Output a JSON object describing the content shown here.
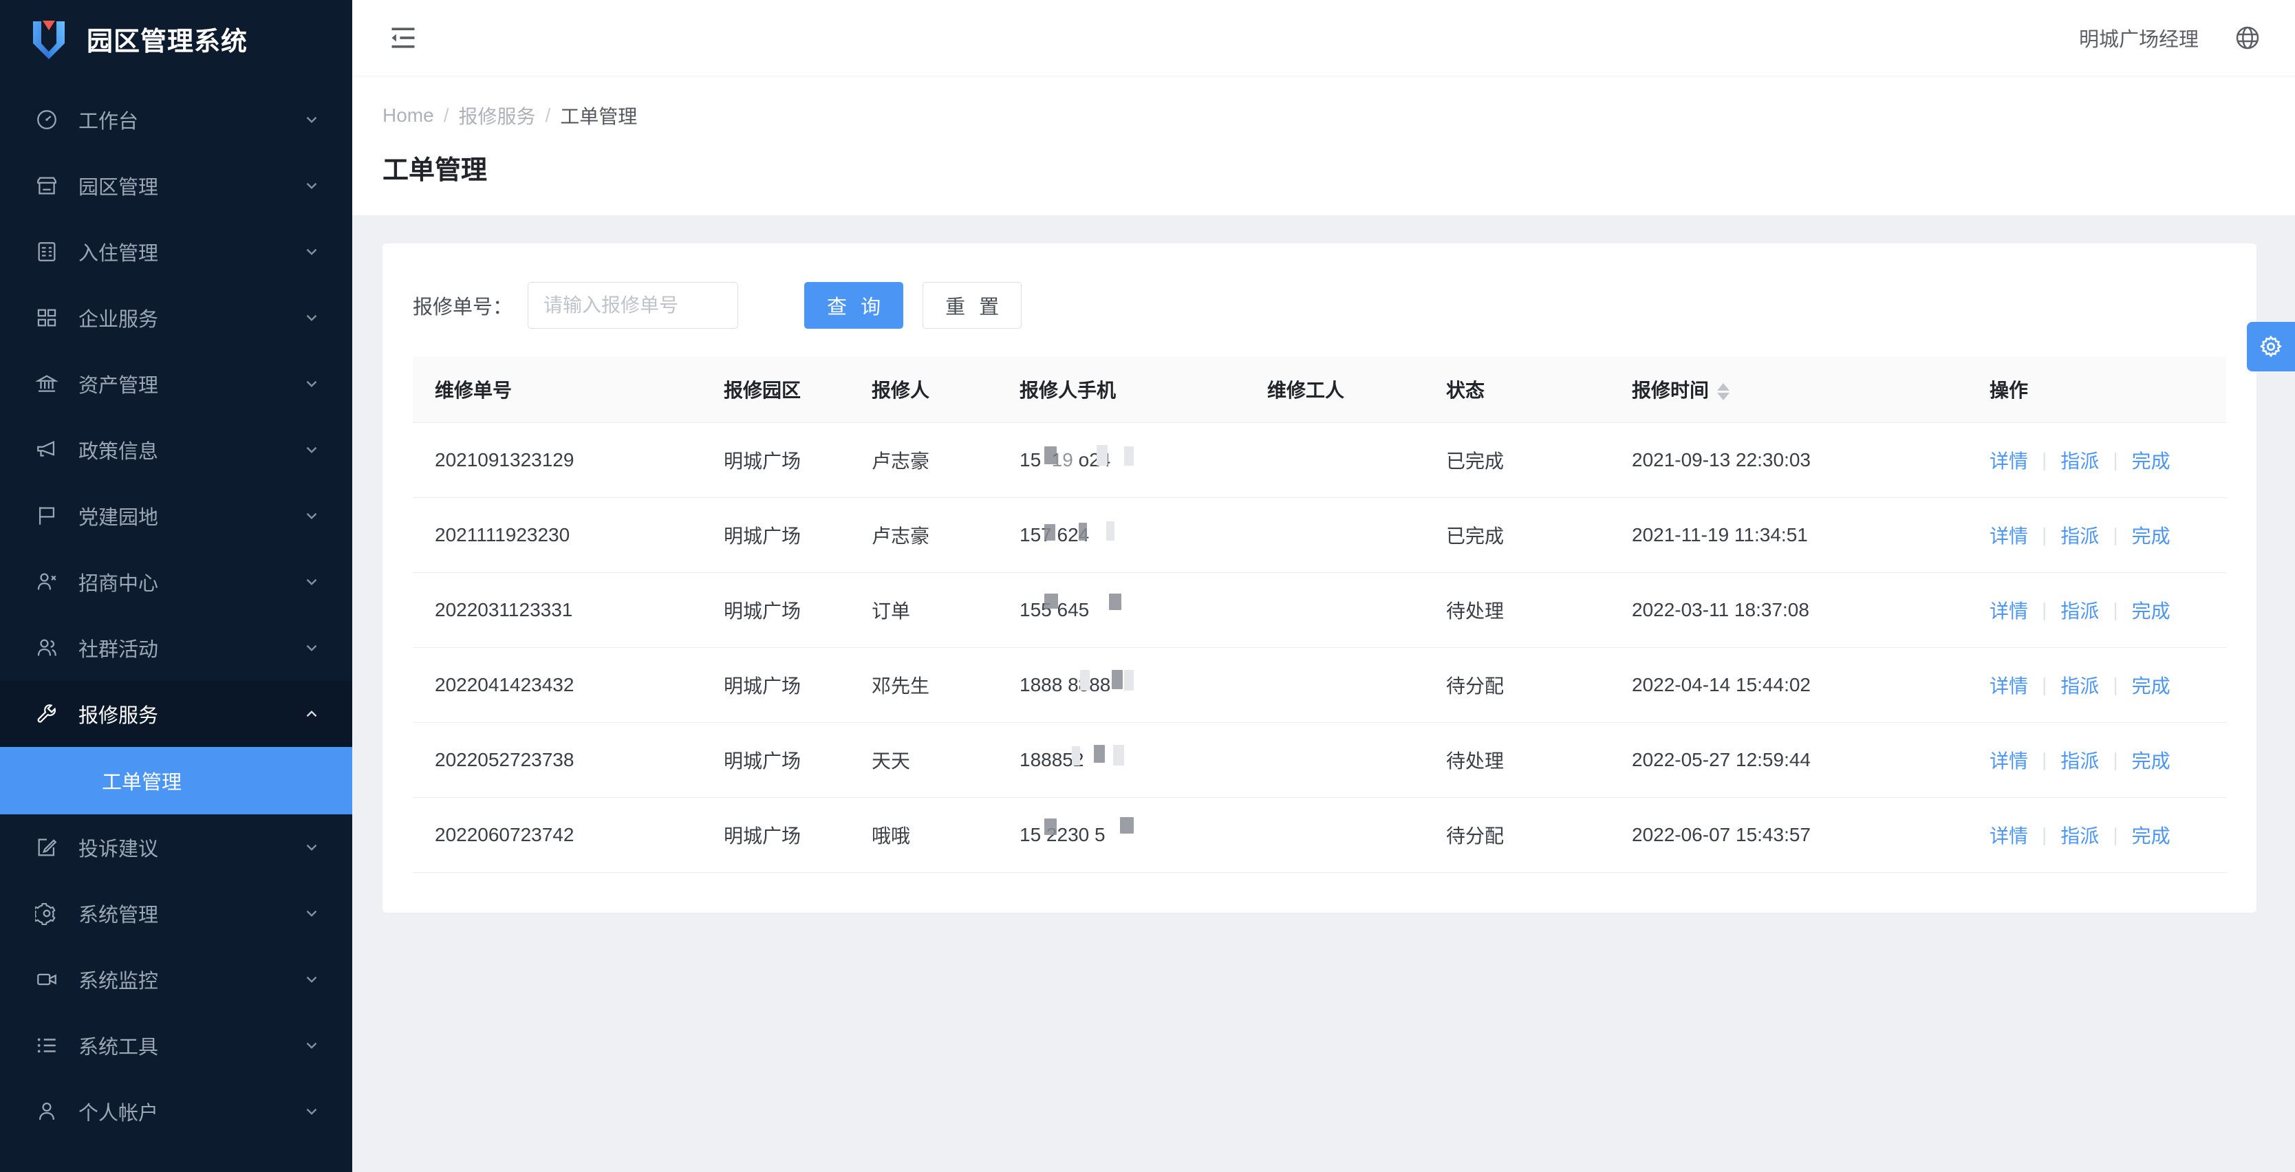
{
  "brand": {
    "title": "园区管理系统",
    "logo_icon": "shield-logo-icon"
  },
  "sidebar": {
    "items": [
      {
        "label": "工作台",
        "icon": "dashboard-icon",
        "arrow": "chevron-down-icon"
      },
      {
        "label": "园区管理",
        "icon": "shop-icon",
        "arrow": "chevron-down-icon"
      },
      {
        "label": "入住管理",
        "icon": "database-icon",
        "arrow": "chevron-down-icon"
      },
      {
        "label": "企业服务",
        "icon": "appstore-icon",
        "arrow": "chevron-down-icon"
      },
      {
        "label": "资产管理",
        "icon": "bank-icon",
        "arrow": "chevron-down-icon"
      },
      {
        "label": "政策信息",
        "icon": "notification-icon",
        "arrow": "chevron-down-icon"
      },
      {
        "label": "党建园地",
        "icon": "flag-icon",
        "arrow": "chevron-down-icon"
      },
      {
        "label": "招商中心",
        "icon": "user-add-icon",
        "arrow": "chevron-down-icon"
      },
      {
        "label": "社群活动",
        "icon": "team-icon",
        "arrow": "chevron-down-icon"
      },
      {
        "label": "报修服务",
        "icon": "wrench-icon",
        "arrow": "chevron-up-icon"
      }
    ],
    "active_submenu": {
      "label": "工单管理"
    },
    "items_after": [
      {
        "label": "投诉建议",
        "icon": "form-icon",
        "arrow": "chevron-down-icon"
      },
      {
        "label": "系统管理",
        "icon": "gear-icon",
        "arrow": "chevron-down-icon"
      },
      {
        "label": "系统监控",
        "icon": "video-camera-icon",
        "arrow": "chevron-down-icon"
      },
      {
        "label": "系统工具",
        "icon": "list-icon",
        "arrow": "chevron-down-icon"
      },
      {
        "label": "个人帐户",
        "icon": "user-icon",
        "arrow": "chevron-down-icon"
      }
    ]
  },
  "topbar": {
    "fold_icon": "menu-fold-icon",
    "user_name": "明城广场经理",
    "globe_icon": "globe-icon"
  },
  "breadcrumb": {
    "items": [
      "Home",
      "报修服务",
      "工单管理"
    ],
    "separator": "/"
  },
  "page_title": "工单管理",
  "search": {
    "label": "报修单号：",
    "placeholder": "请输入报修单号",
    "value": "",
    "query_label": "查 询",
    "reset_label": "重 置"
  },
  "table": {
    "columns": [
      {
        "key": "order_no",
        "label": "维修单号",
        "sortable": false
      },
      {
        "key": "park",
        "label": "报修园区",
        "sortable": false
      },
      {
        "key": "reporter",
        "label": "报修人",
        "sortable": false
      },
      {
        "key": "phone",
        "label": "报修人手机",
        "sortable": false
      },
      {
        "key": "worker",
        "label": "维修工人",
        "sortable": false
      },
      {
        "key": "status",
        "label": "状态",
        "sortable": false
      },
      {
        "key": "report_time",
        "label": "报修时间",
        "sortable": true
      },
      {
        "key": "ops",
        "label": "操作",
        "sortable": false
      }
    ],
    "sort_icon": "sort-updown-icon",
    "ops_labels": [
      "详情",
      "指派",
      "完成"
    ],
    "rows": [
      {
        "order_no": "2021091323129",
        "park": "明城广场",
        "reporter": "卢志豪",
        "phone": "15█ ██9█ █ ██24",
        "worker": "",
        "status": "已完成",
        "report_time": "2021-09-13 22:30:03"
      },
      {
        "order_no": "2021111923230",
        "park": "明城广场",
        "reporter": "卢志豪",
        "phone": "15█7 █9█6█24",
        "worker": "",
        "status": "已完成",
        "report_time": "2021-11-19 11:34:51"
      },
      {
        "order_no": "2022031123331",
        "park": "明城广场",
        "reporter": "订单",
        "phone": "15█5 64█5",
        "worker": "",
        "status": "待处理",
        "report_time": "2022-03-11 18:37:08"
      },
      {
        "order_no": "2022041423432",
        "park": "明城广场",
        "reporter": "邓先生",
        "phone": "1888 ██88█ ██88",
        "worker": "",
        "status": "待分配",
        "report_time": "2022-04-14 15:44:02"
      },
      {
        "order_no": "2022052723738",
        "park": "明城广场",
        "reporter": "天天",
        "phone": "1888█5██2█",
        "worker": "",
        "status": "待处理",
        "report_time": "2022-05-27 12:59:44"
      },
      {
        "order_no": "2022060723742",
        "park": "明城广场",
        "reporter": "哦哦",
        "phone": "15█ █2230█ █5",
        "worker": "",
        "status": "待分配",
        "report_time": "2022-06-07 15:43:57"
      }
    ]
  },
  "settings_handle": {
    "icon": "gear-icon"
  },
  "colors": {
    "sidebar_bg": "#0c1b2e",
    "accent": "#4b96f5",
    "page_bg": "#eff0f4",
    "link": "#4b96f5",
    "logo_red": "#ea5a51"
  }
}
